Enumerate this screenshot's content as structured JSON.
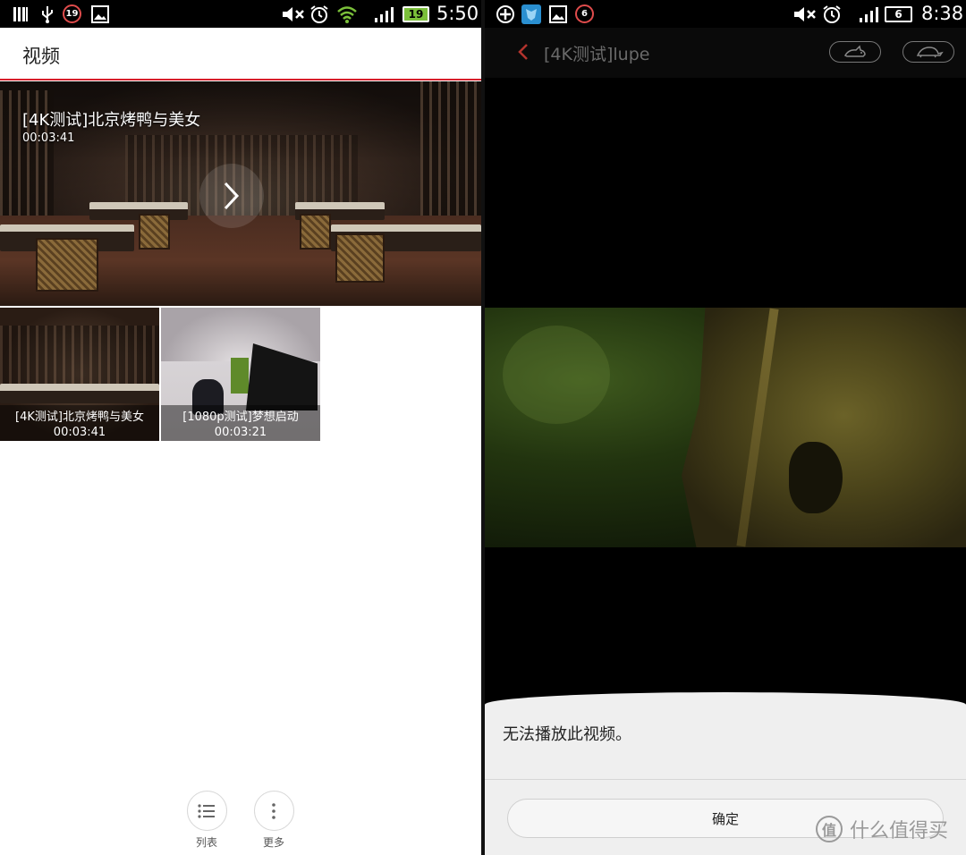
{
  "left": {
    "status_bar": {
      "notification_count": "19",
      "battery": "19",
      "time": "5:50",
      "battery_color": "#7bc03a"
    },
    "header": {
      "title": "视频"
    },
    "hero": {
      "title": "[4K测试]北京烤鸭与美女",
      "duration": "00:03:41"
    },
    "videos": [
      {
        "title": "[4K测试]北京烤鸭与美女",
        "duration": "00:03:41"
      },
      {
        "title": "[1080p测试]梦想启动",
        "duration": "00:03:21"
      }
    ],
    "actions": [
      {
        "label": "列表",
        "icon": "list-icon"
      },
      {
        "label": "更多",
        "icon": "more-vertical-icon"
      }
    ],
    "accent_color": "#d81e2a"
  },
  "right": {
    "status_bar": {
      "notification_count": "6",
      "battery": "6",
      "time": "8:38"
    },
    "player": {
      "title": "[4K测试]lupe",
      "modes": [
        "rabbit-icon",
        "turtle-icon"
      ]
    },
    "dialog": {
      "message": "无法播放此视频。",
      "ok_label": "确定"
    },
    "watermark": {
      "logo": "值",
      "text": "什么值得买"
    }
  }
}
